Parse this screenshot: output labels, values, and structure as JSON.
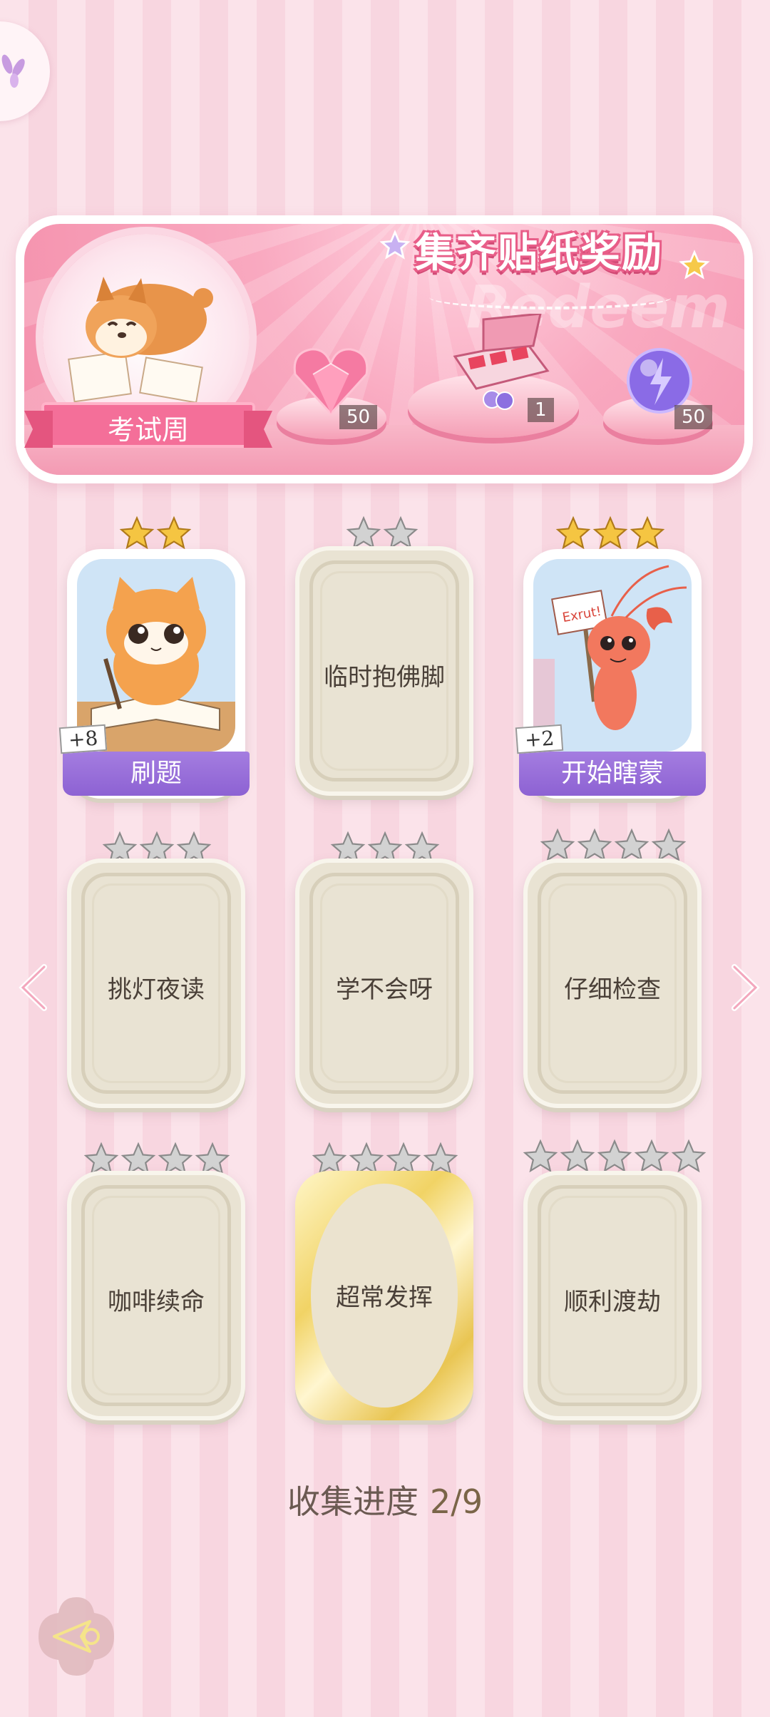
{
  "banner": {
    "title": "集齐贴纸奖励",
    "watermark": "Redeem",
    "theme_label": "考试周",
    "rewards": [
      {
        "icon": "pink-diamond-heart-icon",
        "count": "50"
      },
      {
        "icon": "gift-box-icon",
        "count": "1"
      },
      {
        "icon": "purple-energy-orb-icon",
        "count": "50"
      }
    ]
  },
  "cards": [
    {
      "name": "刷题",
      "stars": 2,
      "owned": true,
      "bonus": "+8",
      "art": "orange-cat-studying"
    },
    {
      "name": "临时抱佛脚",
      "stars": 2,
      "owned": false
    },
    {
      "name": "开始瞎蒙",
      "stars": 3,
      "owned": true,
      "bonus": "+2",
      "art": "shrimp-with-sign",
      "sign_text": "Exrut!"
    },
    {
      "name": "挑灯夜读",
      "stars": 3,
      "owned": false
    },
    {
      "name": "学不会呀",
      "stars": 3,
      "owned": false
    },
    {
      "name": "仔细检查",
      "stars": 4,
      "owned": false
    },
    {
      "name": "咖啡续命",
      "stars": 4,
      "owned": false
    },
    {
      "name": "超常发挥",
      "stars": 4,
      "owned": false,
      "style": "gold"
    },
    {
      "name": "顺利渡劫",
      "stars": 5,
      "owned": false
    }
  ],
  "progress": {
    "label": "收集进度",
    "value": "2/9"
  },
  "colors": {
    "accent_pink": "#f46f99",
    "purple_bar": "#9a70da",
    "gold_star": "#f5c542",
    "silver_star": "#c9c9c9"
  }
}
